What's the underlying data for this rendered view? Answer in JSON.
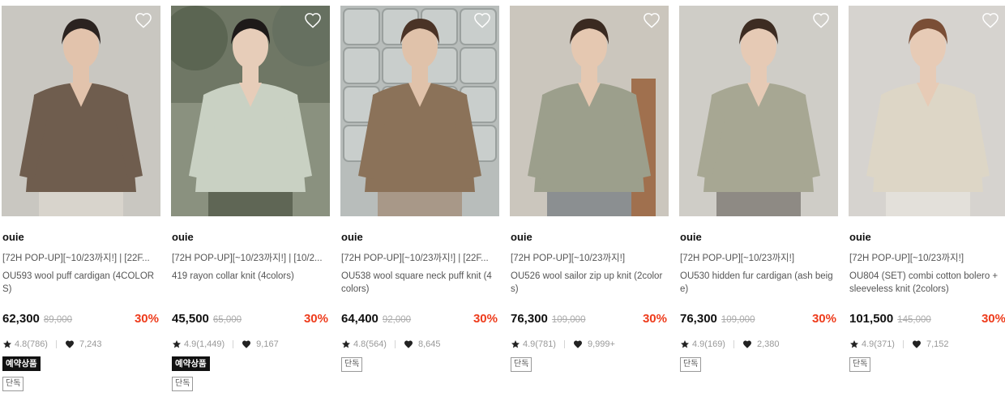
{
  "products": [
    {
      "brand": "ouie",
      "tag": "[72H POP-UP][~10/23까지!] | [22F...",
      "name": "OU593 wool puff cardigan (4COLORS)",
      "price": "62,300",
      "original_price": "89,000",
      "discount": "30%",
      "rating": "4.8(786)",
      "likes": "7,243",
      "badges": [
        "예약상품",
        "단독"
      ],
      "image": "model in brown v-neck cardigan",
      "colors": {
        "bg": "#c9c7c1",
        "garment": "#6f5d4e",
        "skin": "#e2c3ac",
        "hair": "#2b2320",
        "lower": "#d8d4cc"
      }
    },
    {
      "brand": "ouie",
      "tag": "[72H POP-UP][~10/23까지!] | [10/2...",
      "name": "419 rayon collar knit (4colors)",
      "price": "45,500",
      "original_price": "65,000",
      "discount": "30%",
      "rating": "4.9(1,449)",
      "likes": "9,167",
      "badges": [
        "예약상품",
        "단독"
      ],
      "image": "model in mint collar knit outdoors",
      "colors": {
        "bg": "#8a917f",
        "garment": "#c9d1c3",
        "skin": "#e7cdb9",
        "hair": "#1e1a19",
        "lower": "#5f6655"
      }
    },
    {
      "brand": "ouie",
      "tag": "[72H POP-UP][~10/23까지!] | [22F...",
      "name": "OU538 wool square neck puff knit (4colors)",
      "price": "64,400",
      "original_price": "92,000",
      "discount": "30%",
      "rating": "4.8(564)",
      "likes": "8,645",
      "badges": [
        "단독"
      ],
      "image": "model in brown square-neck knit, glass block wall",
      "colors": {
        "bg": "#b8bdbb",
        "garment": "#8b7259",
        "skin": "#e0c2aa",
        "hair": "#4a3326",
        "lower": "#a89888"
      }
    },
    {
      "brand": "ouie",
      "tag": "[72H POP-UP][~10/23까지!]",
      "name": "OU526 wool sailor zip up knit (2colors)",
      "price": "76,300",
      "original_price": "109,000",
      "discount": "30%",
      "rating": "4.9(781)",
      "likes": "9,999+",
      "badges": [
        "단독"
      ],
      "image": "model in sage sailor zip knit",
      "colors": {
        "bg": "#cbc6bd",
        "garment": "#9c9f8c",
        "skin": "#e5c8b1",
        "hair": "#3a2a21",
        "lower": "#8b8f91"
      }
    },
    {
      "brand": "ouie",
      "tag": "[72H POP-UP][~10/23까지!]",
      "name": "OU530 hidden fur cardigan (ash beige)",
      "price": "76,300",
      "original_price": "109,000",
      "discount": "30%",
      "rating": "4.9(169)",
      "likes": "2,380",
      "badges": [
        "단독"
      ],
      "image": "model in ash beige fur cardigan",
      "colors": {
        "bg": "#cfcdc7",
        "garment": "#a7a793",
        "skin": "#e6cab5",
        "hair": "#3d2c22",
        "lower": "#8e8a84"
      }
    },
    {
      "brand": "ouie",
      "tag": "[72H POP-UP][~10/23까지!]",
      "name": "OU804 (SET) combi cotton bolero + sleeveless knit (2colors)",
      "price": "101,500",
      "original_price": "145,000",
      "discount": "30%",
      "rating": "4.9(371)",
      "likes": "7,152",
      "badges": [
        "단독"
      ],
      "image": "model in cream ribbed bolero set",
      "colors": {
        "bg": "#d6d3cf",
        "garment": "#ddd6c6",
        "skin": "#e7cbb6",
        "hair": "#7a4e36",
        "lower": "#e3e0da"
      }
    }
  ],
  "icons": {
    "wishlist": "heart-outline-icon",
    "rating": "star-icon",
    "likes": "heart-filled-icon"
  }
}
